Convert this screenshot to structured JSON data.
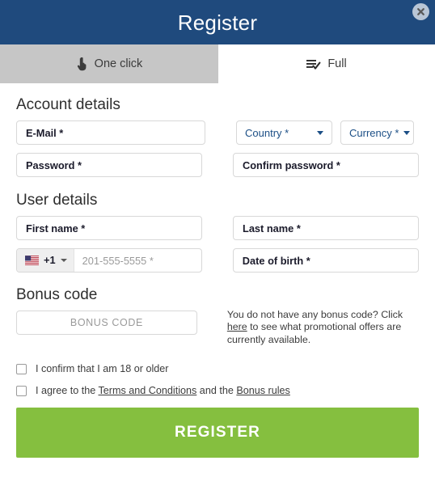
{
  "header": {
    "title": "Register",
    "close_icon": "close-circle-icon"
  },
  "tabs": [
    {
      "id": "one-click",
      "label": "One click",
      "icon": "touch-pointer-icon",
      "active": false
    },
    {
      "id": "full",
      "label": "Full",
      "icon": "list-check-icon",
      "active": true
    }
  ],
  "sections": {
    "account": {
      "title": "Account details",
      "email": {
        "label": "E-Mail *"
      },
      "country": {
        "label": "Country *",
        "icon": "chevron-down-icon"
      },
      "currency": {
        "label": "Currency *",
        "icon": "chevron-down-icon"
      },
      "password": {
        "label": "Password *"
      },
      "confirm_password": {
        "label": "Confirm password *"
      }
    },
    "user": {
      "title": "User details",
      "first_name": {
        "label": "First name *"
      },
      "last_name": {
        "label": "Last name *"
      },
      "phone": {
        "flag": "us-flag-icon",
        "dial_code": "+1",
        "placeholder": "201-555-5555 *",
        "caret_icon": "chevron-down-icon"
      },
      "date_of_birth": {
        "label": "Date of birth *"
      }
    },
    "bonus": {
      "title": "Bonus code",
      "input_placeholder": "BONUS CODE",
      "note_part1": "You do not have any bonus code? Click ",
      "note_link": "here",
      "note_part2": " to see what promotional offers are currently available."
    }
  },
  "agreements": [
    {
      "id": "age-confirm",
      "checked": false,
      "text_part1": "I confirm that I am 18 or older",
      "link1": "",
      "text_part2": "",
      "link2": "",
      "text_part3": ""
    },
    {
      "id": "terms-agree",
      "checked": false,
      "text_part1": "I agree to the ",
      "link1": "Terms and Conditions",
      "text_part2": " and the ",
      "link2": "Bonus rules",
      "text_part3": ""
    }
  ],
  "submit": {
    "label": "REGISTER"
  },
  "colors": {
    "header_bg": "#1f4a7d",
    "tab_inactive_bg": "#c6c6c6",
    "tab_active_bg": "#ffffff",
    "accent_link": "#1c4f86",
    "submit_bg": "#85bf3f",
    "field_border": "#d8d8d8"
  }
}
